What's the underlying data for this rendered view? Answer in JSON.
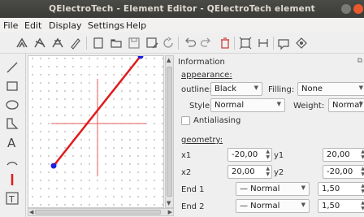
{
  "window": {
    "title": "QElectroTech - Element Editor - QElectroTech element"
  },
  "menu": [
    "File",
    "Edit",
    "Display",
    "Settings",
    "Help"
  ],
  "toolbar_icons": [
    "select-all-icon",
    "deselect-icon",
    "invert-selection-icon",
    "edit-icon",
    "new-icon",
    "open-icon",
    "save-icon",
    "save-as-icon",
    "reload-icon",
    "undo-icon",
    "redo-icon",
    "delete-icon",
    "zoom-fit-icon",
    "zoom-reset-icon",
    "edit-info-icon",
    "preview-icon"
  ],
  "tools": [
    "line-icon",
    "rectangle-icon",
    "ellipse-icon",
    "polygon-icon",
    "text-icon",
    "arc-icon",
    "terminal-icon",
    "text-field-icon"
  ],
  "panel": {
    "title": "Information",
    "appearance_label": "appearance:",
    "outline_label": "outline:",
    "outline_value": "Black",
    "filling_label": "Filling:",
    "filling_value": "None",
    "style_label": "Style:",
    "style_value": "Normal",
    "weight_label": "Weight:",
    "weight_value": "Normal",
    "antialiasing_label": "Antialiasing",
    "geometry_label": "geometry:",
    "x1_label": "x1",
    "x1_value": "-20,00",
    "y1_label": "y1",
    "y1_value": "20,00",
    "x2_label": "x2",
    "x2_value": "20,00",
    "y2_label": "y2",
    "y2_value": "-20,00",
    "end1_label": "End 1",
    "end1_value": "— Normal",
    "end1_length": "1,50",
    "end2_label": "End 2",
    "end2_value": "— Normal",
    "end2_length": "1,50"
  },
  "colors": {
    "accent_line": "#e01b1b",
    "handle": "#1f1fe0",
    "titlebar": "#3c3b37"
  }
}
